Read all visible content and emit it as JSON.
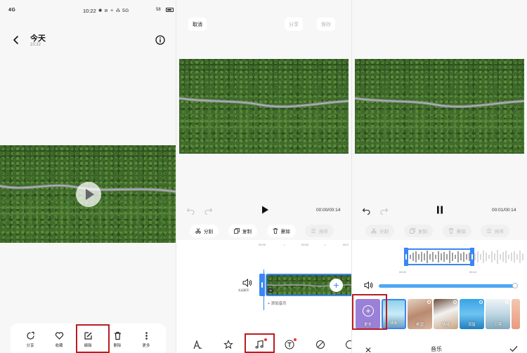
{
  "panel1": {
    "status": {
      "left": "4G",
      "time": "10:22",
      "right": "✱ ⊘ ✧ ⁂ 5G",
      "battery": "58"
    },
    "title": "今天",
    "subtitle": "10:22",
    "bottom_bar": [
      {
        "label": "分享",
        "icon": "share-icon"
      },
      {
        "label": "收藏",
        "icon": "heart-icon"
      },
      {
        "label": "编辑",
        "icon": "edit-icon"
      },
      {
        "label": "删除",
        "icon": "trash-icon"
      },
      {
        "label": "更多",
        "icon": "more-icon"
      }
    ]
  },
  "panel2": {
    "cancel": "取消",
    "share": "分享",
    "save": "保存",
    "time": "00:00/00:14",
    "tools": [
      "分割",
      "复制",
      "删除",
      "排序"
    ],
    "ruler": [
      "00:00",
      "•",
      "00:02",
      "•",
      "00:0"
    ],
    "speaker_label": "关闭原声",
    "badge": "4s",
    "add_music": "+ 添加音乐"
  },
  "panel3": {
    "time": "00:01/00:14",
    "tools": [
      "分割",
      "复制",
      "删除",
      "排序"
    ],
    "ruler": [
      "00:00",
      "00:14"
    ],
    "thumbs": [
      "更多",
      "清新",
      "希望",
      "情绪",
      "流星",
      "日落"
    ],
    "title": "音乐"
  },
  "colors": {
    "accent": "#3b86f5",
    "highlight": "#b81c22"
  }
}
